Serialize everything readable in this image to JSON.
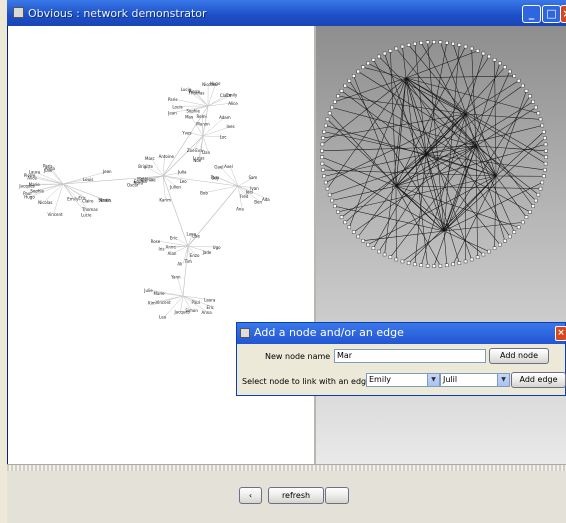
{
  "window": {
    "title": "Obvious : network demonstrator"
  },
  "graph_left": {
    "labels": [
      "Jacques",
      "Eric",
      "Paul",
      "Simon",
      "Laura",
      "Vincent",
      "Julie",
      "Marie",
      "Anna",
      "Pierre",
      "Emily",
      "Jean",
      "Claire",
      "Louis",
      "Hugo",
      "Paris",
      "Lucie",
      "Sophie",
      "Alice",
      "Thomas",
      "Nicolas",
      "Nadia",
      "Karim",
      "Mathieu",
      "Brigitte",
      "Antoine",
      "Julien",
      "Camille",
      "Leo",
      "Marc",
      "Julia",
      "Nora",
      "Oscar",
      "Emma",
      "Eva",
      "Manon",
      "Lucas",
      "Adam",
      "Ines",
      "Remi",
      "Yves",
      "Zoe",
      "Dan",
      "Max",
      "Noe",
      "Luc",
      "Guy",
      "Ada",
      "Bob",
      "Tom",
      "Ben",
      "Sam",
      "Ivan",
      "Axel",
      "Gael",
      "Ana",
      "Fred",
      "Joel",
      "Rose",
      "Lise",
      "Anne",
      "Ali",
      "Jade",
      "Tim",
      "Luna",
      "Enzo",
      "Eric",
      "Alan",
      "Iris",
      "Ugo",
      "Kim",
      "Lea",
      "Yann"
    ]
  },
  "dialog": {
    "title": "Add a node and/or an edge",
    "node_name_label": "New node name",
    "node_name_value": "Mar",
    "add_node_label": "Add node",
    "link_label": "Select node to link with an edge",
    "link_from_value": "Emily",
    "link_to_value": "Julil",
    "add_edge_label": "Add edge"
  },
  "bottom": {
    "prev_label": "‹",
    "refresh_label": "refresh",
    "next_label": ""
  }
}
